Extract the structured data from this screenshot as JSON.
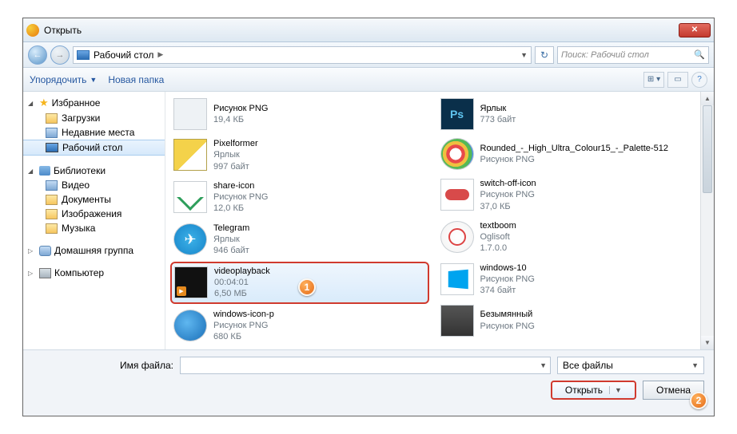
{
  "window": {
    "title": "Открыть"
  },
  "breadcrumb": {
    "location": "Рабочий стол"
  },
  "search": {
    "placeholder": "Поиск: Рабочий стол"
  },
  "toolbar": {
    "organize": "Упорядочить",
    "newfolder": "Новая папка"
  },
  "sidebar": {
    "favorites": {
      "label": "Избранное",
      "items": [
        {
          "label": "Загрузки"
        },
        {
          "label": "Недавние места"
        },
        {
          "label": "Рабочий стол",
          "selected": true
        }
      ]
    },
    "libraries": {
      "label": "Библиотеки",
      "items": [
        {
          "label": "Видео"
        },
        {
          "label": "Документы"
        },
        {
          "label": "Изображения"
        },
        {
          "label": "Музыка"
        }
      ]
    },
    "homegroup": {
      "label": "Домашняя группа"
    },
    "computer": {
      "label": "Компьютер"
    }
  },
  "files": {
    "col1": [
      {
        "name": "Рисунок PNG",
        "line2": "19,4 КБ",
        "line3": "",
        "thumb": "png"
      },
      {
        "name": "Pixelformer",
        "line2": "Ярлык",
        "line3": "997 байт",
        "thumb": "pixel"
      },
      {
        "name": "share-icon",
        "line2": "Рисунок PNG",
        "line3": "12,0 КБ",
        "thumb": "share"
      },
      {
        "name": "Telegram",
        "line2": "Ярлык",
        "line3": "946 байт",
        "thumb": "tg"
      },
      {
        "name": "videoplayback",
        "line2": "00:04:01",
        "line3": "6,50 МБ",
        "thumb": "video",
        "selected": true
      },
      {
        "name": "windows-icon-p",
        "line2": "Рисунок PNG",
        "line3": "680 КБ",
        "thumb": "winicon"
      }
    ],
    "col2": [
      {
        "name": "Ярлык",
        "line2": "773 байт",
        "line3": "",
        "thumb": "ps"
      },
      {
        "name": "Rounded_-_High_Ultra_Colour15_-_Palette-512",
        "line2": "Рисунок PNG",
        "line3": "",
        "thumb": "palette"
      },
      {
        "name": "switch-off-icon",
        "line2": "Рисунок PNG",
        "line3": "37,0 КБ",
        "thumb": "switch"
      },
      {
        "name": "textboom",
        "line2": "Oglisoft",
        "line3": "1.7.0.0",
        "thumb": "textboom"
      },
      {
        "name": "windows-10",
        "line2": "Рисунок PNG",
        "line3": "374 байт",
        "thumb": "win10"
      },
      {
        "name": "Безымянный",
        "line2": "Рисунок PNG",
        "line3": "",
        "thumb": "blank"
      }
    ]
  },
  "footer": {
    "filename_label": "Имя файла:",
    "filename_value": "",
    "filetype": "Все файлы",
    "open": "Открыть",
    "cancel": "Отмена"
  },
  "callouts": {
    "one": "1",
    "two": "2"
  }
}
